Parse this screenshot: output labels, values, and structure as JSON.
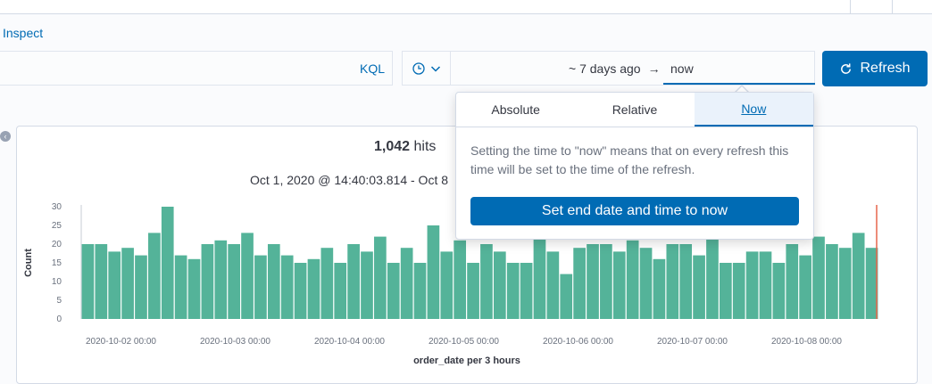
{
  "toolbar": {
    "inspect_label": "Inspect"
  },
  "query_bar": {
    "language_label": "KQL"
  },
  "date_picker": {
    "start": "~ 7 days ago",
    "arrow": "→",
    "end": "now",
    "refresh_label": "Refresh"
  },
  "popover": {
    "tabs": [
      {
        "label": "Absolute"
      },
      {
        "label": "Relative"
      },
      {
        "label": "Now"
      }
    ],
    "active_tab": "Now",
    "description": "Setting the time to \"now\" means that on every refresh this time will be set to the time of the refresh.",
    "button_label": "Set end date and time to now"
  },
  "summary": {
    "hits_count": "1,042",
    "hits_label": "hits",
    "date_range": "Oct 1, 2020 @ 14:40:03.814 - Oct 8"
  },
  "colors": {
    "accent": "#006bb4",
    "bar": "#54b399",
    "now_marker": "#e7664c"
  },
  "chart_data": {
    "type": "bar",
    "ylabel": "Count",
    "xlabel": "order_date per 3 hours",
    "ylim": [
      0,
      30
    ],
    "yticks": [
      0,
      5,
      10,
      15,
      20,
      25,
      30
    ],
    "xtick_labels": [
      "2020-10-02 00:00",
      "2020-10-03 00:00",
      "2020-10-04 00:00",
      "2020-10-05 00:00",
      "2020-10-06 00:00",
      "2020-10-07 00:00",
      "2020-10-08 00:00"
    ],
    "values": [
      20,
      20,
      18,
      19,
      17,
      23,
      30,
      17,
      16,
      20,
      21,
      20,
      23,
      17,
      20,
      17,
      15,
      16,
      19,
      15,
      20,
      18,
      22,
      15,
      19,
      15,
      25,
      18,
      21,
      15,
      20,
      18,
      15,
      15,
      22,
      18,
      12,
      19,
      20,
      20,
      18,
      21,
      19,
      16,
      20,
      20,
      17,
      22,
      15,
      15,
      18,
      18,
      15,
      20,
      17,
      22,
      20,
      19,
      23,
      19
    ]
  }
}
